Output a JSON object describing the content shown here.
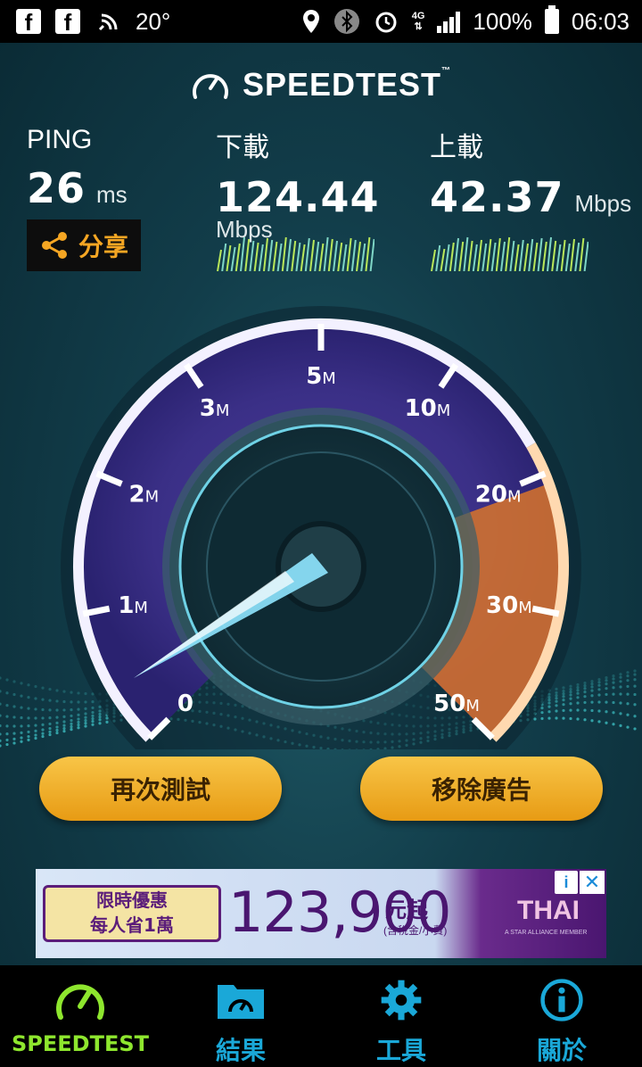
{
  "status_bar": {
    "temperature": "20°",
    "network": "4G",
    "battery": "100%",
    "time": "06:03",
    "icons": [
      "facebook-icon",
      "facebook-icon",
      "wifi-calling-icon",
      "location-icon",
      "bluetooth-icon",
      "alarm-icon",
      "signal-icon",
      "battery-icon"
    ]
  },
  "header": {
    "logo": "SPEEDTEST",
    "trademark": "™"
  },
  "ping": {
    "label": "PING",
    "value": "26",
    "unit": "ms"
  },
  "download": {
    "label": "下載",
    "value": "124.44",
    "unit": "Mbps"
  },
  "upload": {
    "label": "上載",
    "value": "42.37",
    "unit": "Mbps"
  },
  "share": {
    "label": "分享"
  },
  "gauge": {
    "ticks": [
      {
        "num": "0",
        "unit": ""
      },
      {
        "num": "1",
        "unit": "M"
      },
      {
        "num": "2",
        "unit": "M"
      },
      {
        "num": "3",
        "unit": "M"
      },
      {
        "num": "5",
        "unit": "M"
      },
      {
        "num": "10",
        "unit": "M"
      },
      {
        "num": "20",
        "unit": "M"
      },
      {
        "num": "30",
        "unit": "M"
      },
      {
        "num": "50",
        "unit": "M"
      }
    ],
    "colors": {
      "arc": "#7d4fc7",
      "high": "#f08a24",
      "needle": "#8fe6ff"
    }
  },
  "actions": {
    "retest": "再次測試",
    "remove_ads": "移除廣告"
  },
  "ad": {
    "promo_line1": "限時優惠",
    "promo_line2": "每人省1萬",
    "price": "123,900",
    "suffix": "元起",
    "suffix_sub": "(含稅金/小費)",
    "brand": "THAI",
    "alliance": "A STAR ALLIANCE MEMBER",
    "info": "i",
    "close": "✕"
  },
  "nav": [
    {
      "label": "SPEEDTEST",
      "icon": "speedometer-icon",
      "active": true
    },
    {
      "label": "結果",
      "icon": "results-folder-icon",
      "active": false
    },
    {
      "label": "工具",
      "icon": "gear-icon",
      "active": false
    },
    {
      "label": "關於",
      "icon": "info-icon",
      "active": false
    }
  ]
}
